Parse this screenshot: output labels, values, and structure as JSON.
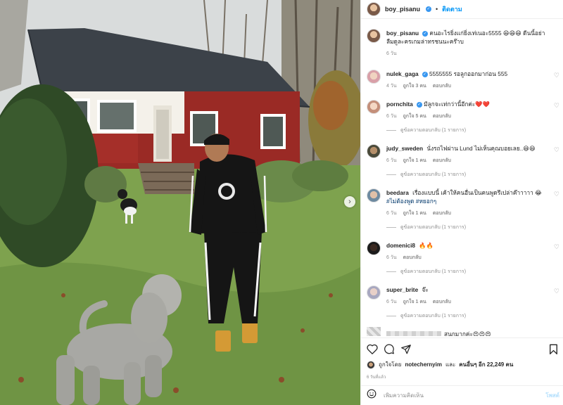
{
  "post": {
    "author": "boy_pisanu",
    "follow_label": "ติดตาม",
    "dot": "•",
    "caption": "คนอะไรยิ่งแก่ยิ่งเท่เนอะ5555 😄😄😄 ดีนนี้อย่าลืมดูละครเกมล่าทรชนนะคร๊าบ",
    "caption_time": "6 วัน",
    "photo_description_icon": "house-dogs-photo",
    "next_icon": "chevron-right-icon"
  },
  "comments": [
    {
      "user": "nulek_gaga",
      "verified": true,
      "text": "5555555 รอลูกออกมาก่อน 555",
      "time": "4 วัน",
      "likes": "ถูกใจ 3 คน",
      "reply": "ตอบกลับ",
      "replies": ""
    },
    {
      "user": "pornchita",
      "verified": true,
      "text": "มีลูกจะเท่กว่านี้อีกค่ะ❤️❤️",
      "time": "6 วัน",
      "likes": "ถูกใจ 5 คน",
      "reply": "ตอบกลับ",
      "replies": "ดูข้อความตอบกลับ (1 รายการ)"
    },
    {
      "user": "judy_sweden",
      "verified": false,
      "text": "นั่งรถไฟผ่าน Lund ไม่เห็นคุณบอยเลย..😄😄",
      "time": "6 วัน",
      "likes": "ถูกใจ 1 คน",
      "reply": "ตอบกลับ",
      "replies": "ดูข้อความตอบกลับ (1 รายการ)"
    },
    {
      "user": "beedara",
      "verified": false,
      "text": "เรื่องแบบนี้ เค้าให้คนอื่นเป็นคนพูดรึเปล่าค๊าาาาา 😂",
      "hashtag": "#ไม่ต้องพูด #หยอกๆ",
      "time": "6 วัน",
      "likes": "ถูกใจ 1 คน",
      "reply": "ตอบกลับ",
      "replies": "ดูข้อความตอบกลับ (1 รายการ)"
    },
    {
      "user": "domenici8",
      "verified": false,
      "text": "🔥🔥",
      "time": "6 วัน",
      "likes": "",
      "reply": "ตอบกลับ",
      "replies": "ดูข้อความตอบกลับ (1 รายการ)"
    },
    {
      "user": "super_brite",
      "verified": false,
      "text": "จ๊ะ",
      "time": "6 วัน",
      "likes": "ถูกใจ 1 คน",
      "reply": "ตอบกลับ",
      "replies": "ดูข้อความตอบกลับ (1 รายการ)"
    },
    {
      "user": "",
      "verified": false,
      "text": "สนุกมากค่ะ😍😍😍",
      "time": "",
      "likes": "",
      "reply": "",
      "replies": ""
    }
  ],
  "likes_line": {
    "prefix": "ถูกใจโดย",
    "user": "notechernyim",
    "and": "และ",
    "others": "คนอื่นๆ อีก 22,249 คน"
  },
  "post_date": "6 วันที่แล้ว",
  "add_comment": {
    "placeholder": "เพิ่มความคิดเห็น",
    "post_label": "โพสต์"
  },
  "colors": {
    "accent": "#0095f6",
    "verified": "#3897f0",
    "muted": "#8e8e8e"
  }
}
